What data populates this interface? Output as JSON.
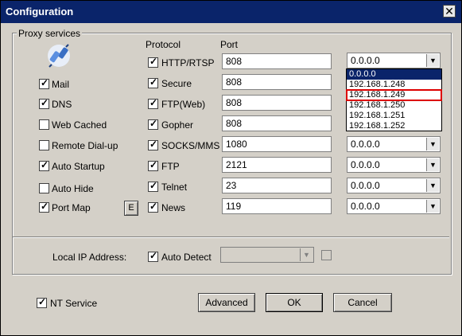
{
  "window": {
    "title": "Configuration"
  },
  "proxy_group": {
    "title": "Proxy services"
  },
  "headers": {
    "protocol": "Protocol",
    "port": "Port"
  },
  "left_options": [
    {
      "label": "Mail",
      "checked": true
    },
    {
      "label": "DNS",
      "checked": true
    },
    {
      "label": "Web Cached",
      "checked": false
    },
    {
      "label": "Remote Dial-up",
      "checked": false
    },
    {
      "label": "Auto Startup",
      "checked": true
    },
    {
      "label": "Auto Hide",
      "checked": false
    },
    {
      "label": "Port Map",
      "checked": true
    }
  ],
  "port_map_edit": {
    "label": "E"
  },
  "protocols": [
    {
      "label": "HTTP/RTSP",
      "checked": true,
      "port": "808",
      "ip": "0.0.0.0"
    },
    {
      "label": "Secure",
      "checked": true,
      "port": "808",
      "ip": "0.0.0.0"
    },
    {
      "label": "FTP(Web)",
      "checked": true,
      "port": "808",
      "ip": "0.0.0.0"
    },
    {
      "label": "Gopher",
      "checked": true,
      "port": "808",
      "ip": "0.0.0.0"
    },
    {
      "label": "SOCKS/MMS",
      "checked": true,
      "port": "1080",
      "ip": "0.0.0.0"
    },
    {
      "label": "FTP",
      "checked": true,
      "port": "2121",
      "ip": "0.0.0.0"
    },
    {
      "label": "Telnet",
      "checked": true,
      "port": "23",
      "ip": "0.0.0.0"
    },
    {
      "label": "News",
      "checked": true,
      "port": "119",
      "ip": "0.0.0.0"
    }
  ],
  "ip_dropdown": {
    "options": [
      "0.0.0.0",
      "192.168.1.248",
      "192.168.1.249",
      "192.168.1.250",
      "192.168.1.251",
      "192.168.1.252"
    ],
    "selected_index": 0,
    "highlighted_index": 2
  },
  "local_ip": {
    "label": "Local IP Address:",
    "auto_detect_label": "Auto Detect",
    "auto_detect_checked": true
  },
  "nt_service": {
    "label": "NT Service",
    "checked": true
  },
  "buttons": {
    "advanced": "Advanced",
    "ok": "OK",
    "cancel": "Cancel"
  }
}
